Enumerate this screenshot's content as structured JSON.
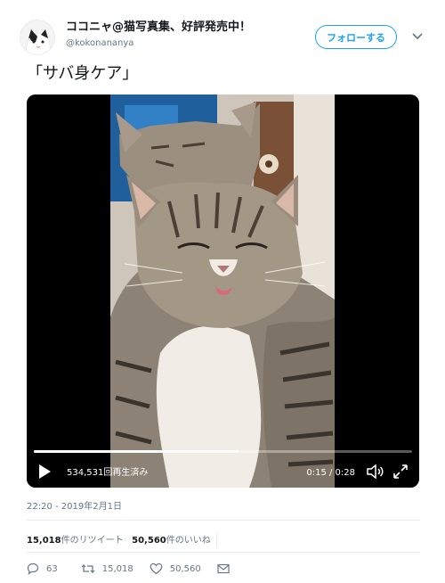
{
  "user": {
    "display_name": "ココニャ@猫写真集、好評発売中！",
    "handle": "@kokonananya",
    "follow_label": "フォローする"
  },
  "tweet": {
    "text": "「サバ身ケア」",
    "timestamp": "22:20 - 2019年2月1日"
  },
  "video": {
    "views": "534,531回再生済み",
    "time": "0:15 / 0:28",
    "progress": 0.54
  },
  "stats": {
    "retweets_count": "15,018",
    "retweets_label": "件のリツイート",
    "likes_count": "50,560",
    "likes_label": "件のいいね"
  },
  "actions": {
    "replies": "63",
    "retweets": "15,018",
    "likes": "50,560"
  },
  "colors": {
    "accent": "#1da1f2",
    "secondary_text": "#657786"
  }
}
